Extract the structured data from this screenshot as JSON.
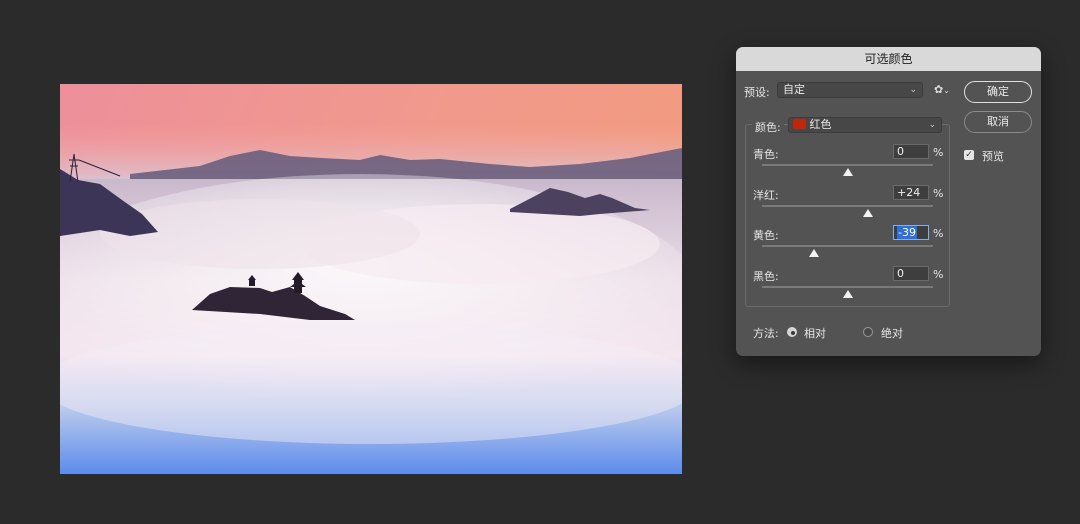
{
  "dialog": {
    "title": "可选颜色",
    "preset_label": "预设:",
    "preset_value": "自定",
    "gear_symbol": "✿",
    "gear_caret": "⌄",
    "ok_label": "确定",
    "cancel_label": "取消",
    "preview_label": "预览",
    "preview_checked": true,
    "colors_label": "颜色:",
    "colors_value": "红色",
    "colors_swatch": "#c2250e",
    "sliders": [
      {
        "label": "青色:",
        "value": "0",
        "position": 0.5
      },
      {
        "label": "洋红:",
        "value": "+24",
        "position": 0.62
      },
      {
        "label": "黄色:",
        "value": "-39",
        "position": 0.305
      },
      {
        "label": "黑色:",
        "value": "0",
        "position": 0.5
      }
    ],
    "percent_sign": "%",
    "method_label": "方法:",
    "method_options": [
      {
        "label": "相对",
        "selected": true
      },
      {
        "label": "绝对",
        "selected": false
      }
    ]
  },
  "theme": {
    "app_background": "#2b2b2b",
    "dialog_background": "#535353",
    "title_bar": "#d9d9d9",
    "selection_highlight": "#2f6fd6"
  }
}
